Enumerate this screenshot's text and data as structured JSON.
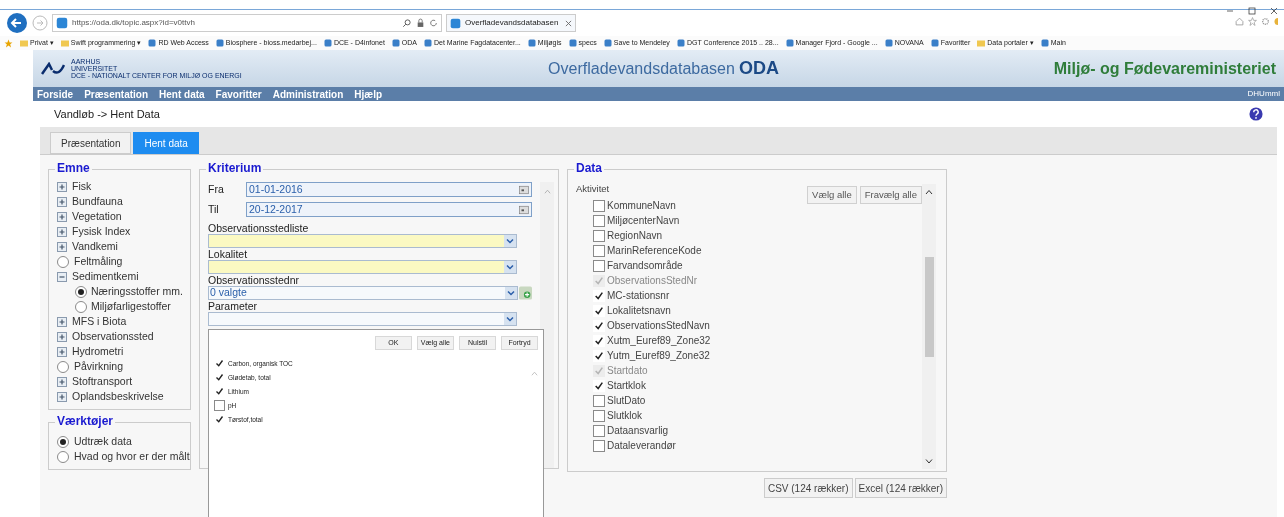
{
  "browser": {
    "address": "https://oda.dk/topic.aspx?id=v0ttvh",
    "tab_title": "Overfladevandsdatabasen",
    "bookmarks": [
      {
        "label": "Privat ▾",
        "kind": "folder"
      },
      {
        "label": "Swift programmering ▾",
        "kind": "folder"
      },
      {
        "label": "RD Web Access",
        "kind": "page"
      },
      {
        "label": "Biosphere - bioss.medarbej...",
        "kind": "page"
      },
      {
        "label": "DCE - D4infonet",
        "kind": "page"
      },
      {
        "label": "ODA",
        "kind": "page"
      },
      {
        "label": "Det Marine Fagdatacenter...",
        "kind": "page"
      },
      {
        "label": "Miljøgis",
        "kind": "page"
      },
      {
        "label": "specs",
        "kind": "page"
      },
      {
        "label": "Save to Mendeley",
        "kind": "page"
      },
      {
        "label": "DGT Conference 2015 .. 28...",
        "kind": "page"
      },
      {
        "label": "Manager Fjord - Google ...",
        "kind": "page"
      },
      {
        "label": "NOVANA",
        "kind": "page"
      },
      {
        "label": "Favoritter",
        "kind": "page"
      },
      {
        "label": "Data portaler ▾",
        "kind": "folder"
      },
      {
        "label": "Main",
        "kind": "page"
      }
    ]
  },
  "header": {
    "university": "AARHUS UNIVERSITET",
    "centre": "DCE - NATIONALT CENTER FOR MILJØ OG ENERGI",
    "site_title": "Overfladevandsdatabasen",
    "site_abbr": "ODA",
    "ministry": "Miljø- og Fødevareministeriet"
  },
  "nav": {
    "items": [
      "Forside",
      "Præsentation",
      "Hent data",
      "Favoritter",
      "Administration",
      "Hjælp"
    ],
    "user": "DHUmml"
  },
  "breadcrumb": "Vandløb -> Hent Data",
  "tabs": [
    {
      "label": "Præsentation",
      "selected": false
    },
    {
      "label": "Hent data",
      "selected": true
    }
  ],
  "emne": {
    "title": "Emne",
    "items": [
      {
        "label": "Fisk",
        "kind": "expand"
      },
      {
        "label": "Bundfauna",
        "kind": "expand"
      },
      {
        "label": "Vegetation",
        "kind": "expand"
      },
      {
        "label": "Fysisk Index",
        "kind": "expand"
      },
      {
        "label": "Vandkemi",
        "kind": "expand"
      },
      {
        "label": "Feltmåling",
        "kind": "radio",
        "selected": false
      },
      {
        "label": "Sedimentkemi",
        "kind": "expand",
        "expanded": true,
        "children": [
          {
            "label": "Næringsstoffer mm.",
            "kind": "radio",
            "selected": true
          },
          {
            "label": "Miljøfarligestoffer",
            "kind": "radio",
            "selected": false
          }
        ]
      },
      {
        "label": "MFS i Biota",
        "kind": "expand"
      },
      {
        "label": "Observationssted",
        "kind": "expand"
      },
      {
        "label": "Hydrometri",
        "kind": "expand"
      },
      {
        "label": "Påvirkning",
        "kind": "radio",
        "selected": false
      },
      {
        "label": "Stoftransport",
        "kind": "expand"
      },
      {
        "label": "Oplandsbeskrivelse",
        "kind": "expand"
      }
    ]
  },
  "tools": {
    "title": "Værktøjer",
    "items": [
      {
        "label": "Udtræk data",
        "selected": true
      },
      {
        "label": "Hvad og hvor er der målt",
        "selected": false
      }
    ]
  },
  "kriterium": {
    "title": "Kriterium",
    "from_label": "Fra",
    "from": "01-01-2016",
    "to_label": "Til",
    "to": "20-12-2017",
    "fields": [
      {
        "label": "Observationsstedliste",
        "kind": "required"
      },
      {
        "label": "Lokalitet",
        "kind": "required"
      },
      {
        "label": "Observationsstednr",
        "value": "0 valgte",
        "kind": "add"
      },
      {
        "label": "Parameter",
        "kind": "plain"
      }
    ],
    "popup": {
      "buttons": [
        "OK",
        "Vælg alle",
        "Nulstil",
        "Fortryd"
      ],
      "items": [
        {
          "label": "Carbon, organisk TOC",
          "checked": true
        },
        {
          "label": "Glødetab, total",
          "checked": true
        },
        {
          "label": "Lithium",
          "checked": true
        },
        {
          "label": "pH",
          "checked": false
        },
        {
          "label": "Tørstof,total",
          "checked": true
        }
      ]
    }
  },
  "data": {
    "title": "Data",
    "list_label": "Aktivitet",
    "buttons": [
      "Vælg alle",
      "Fravælg alle"
    ],
    "items": [
      {
        "label": "KommuneNavn",
        "checked": false,
        "disabled": false
      },
      {
        "label": "MiljøcenterNavn",
        "checked": false,
        "disabled": false
      },
      {
        "label": "RegionNavn",
        "checked": false,
        "disabled": false
      },
      {
        "label": "MarinReferenceKode",
        "checked": false,
        "disabled": false
      },
      {
        "label": "Farvandsområde",
        "checked": false,
        "disabled": false
      },
      {
        "label": "ObservationsStedNr",
        "checked": true,
        "disabled": true
      },
      {
        "label": "MC-stationsnr",
        "checked": true,
        "disabled": false
      },
      {
        "label": "Lokalitetsnavn",
        "checked": true,
        "disabled": false
      },
      {
        "label": "ObservationsStedNavn",
        "checked": true,
        "disabled": false
      },
      {
        "label": "Xutm_Euref89_Zone32",
        "checked": true,
        "disabled": false
      },
      {
        "label": "Yutm_Euref89_Zone32",
        "checked": true,
        "disabled": false
      },
      {
        "label": "Startdato",
        "checked": true,
        "disabled": true
      },
      {
        "label": "Startklok",
        "checked": true,
        "disabled": false
      },
      {
        "label": "SlutDato",
        "checked": false,
        "disabled": false
      },
      {
        "label": "Slutklok",
        "checked": false,
        "disabled": false
      },
      {
        "label": "Dataansvarlig",
        "checked": false,
        "disabled": false
      },
      {
        "label": "Dataleverandør",
        "checked": false,
        "disabled": false
      }
    ],
    "export_buttons": [
      "CSV (124 rækker)",
      "Excel (124 rækker)"
    ]
  }
}
